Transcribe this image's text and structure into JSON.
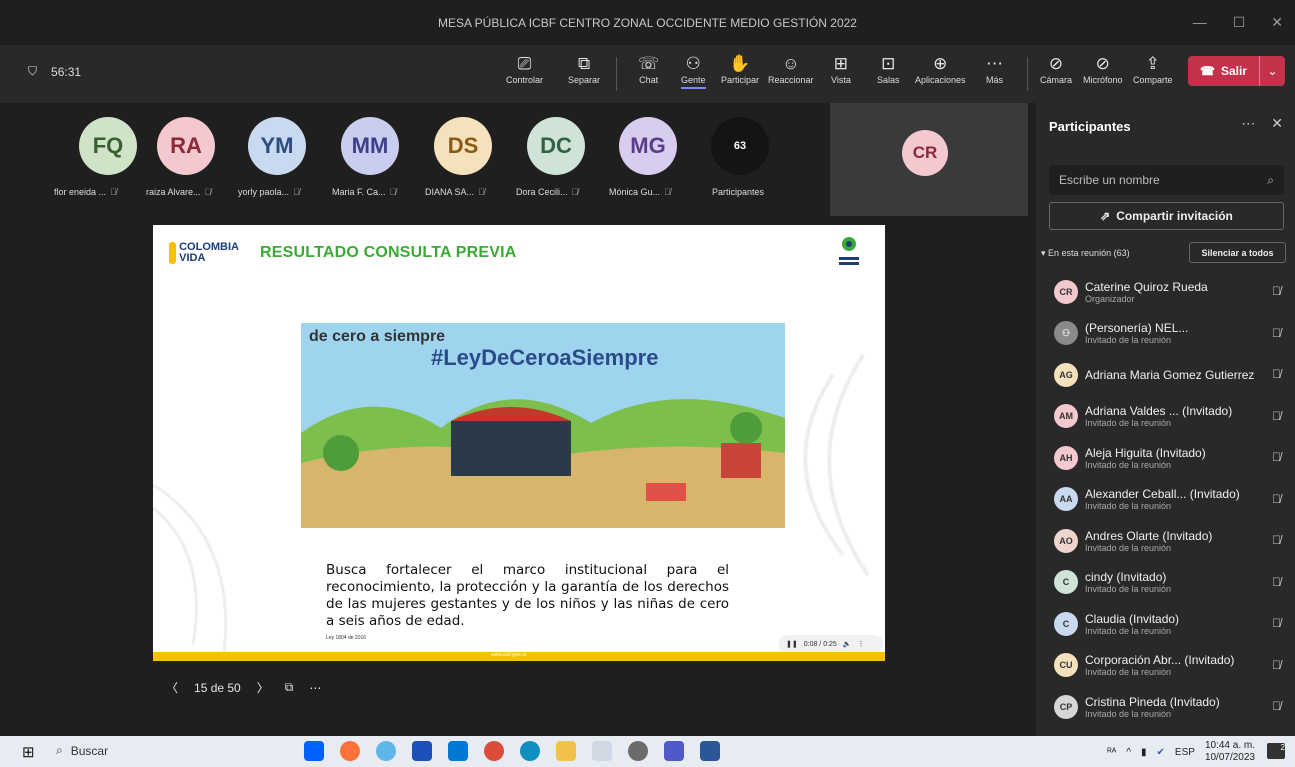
{
  "window": {
    "title": "MESA PÚBLICA ICBF CENTRO ZONAL OCCIDENTE MEDIO GESTIÓN 2022",
    "controls": [
      "—",
      "☐",
      "✕"
    ]
  },
  "meeting": {
    "timer": "56:31"
  },
  "toolbar": {
    "items": [
      {
        "label": "Controlar",
        "icon": "monitor-icon"
      },
      {
        "label": "Separar",
        "icon": "popout-icon"
      },
      {
        "label": "Chat",
        "icon": "chat-icon"
      },
      {
        "label": "Gente",
        "icon": "people-icon",
        "active": true
      },
      {
        "label": "Participar",
        "icon": "raise-hand-icon"
      },
      {
        "label": "Reaccionar",
        "icon": "emoji-icon"
      },
      {
        "label": "Vista",
        "icon": "grid-icon"
      },
      {
        "label": "Salas",
        "icon": "rooms-icon"
      },
      {
        "label": "Aplicaciones",
        "icon": "add-app-icon"
      },
      {
        "label": "Más",
        "icon": "more-icon"
      },
      {
        "label": "Cámara",
        "icon": "camera-off-icon"
      },
      {
        "label": "Micrófono",
        "icon": "mic-off-icon"
      },
      {
        "label": "Comparte",
        "icon": "share-icon"
      }
    ],
    "leave_label": "Salir",
    "accent": "#7f85f5",
    "leave_color": "#c4314b"
  },
  "gallery": {
    "avatars": [
      {
        "initials": "FQ",
        "name": "flor eneida ...",
        "bg": "#cfe3c8",
        "fg": "#3a5f2e"
      },
      {
        "initials": "RA",
        "name": "raiza Alvare...",
        "bg": "#f3c8cf",
        "fg": "#8a2a3b"
      },
      {
        "initials": "YM",
        "name": "yorly paola...",
        "bg": "#c8d9f0",
        "fg": "#2b4c7e"
      },
      {
        "initials": "MM",
        "name": "Maria F. Ca...",
        "bg": "#c9cdef",
        "fg": "#3e3f8a"
      },
      {
        "initials": "DS",
        "name": "DIANA SA...",
        "bg": "#f6e1bd",
        "fg": "#8a5a12"
      },
      {
        "initials": "DC",
        "name": "Dora Cecili...",
        "bg": "#cfe3d6",
        "fg": "#2f6145"
      },
      {
        "initials": "MG",
        "name": "Mónica Gu...",
        "bg": "#d9cdef",
        "fg": "#5a3e8a"
      }
    ],
    "overflow_count": "63",
    "overflow_label": "Participantes",
    "spotlight_initials": "CR"
  },
  "slide": {
    "logo_text": "COLOMBIA\nVIDA",
    "heading": "RESULTADO CONSULTA PREVIA",
    "banner_hashtag": "#LeyDeCeroaSiempre",
    "banner_brand": "de cero a siempre",
    "body": "Busca fortalecer el marco institucional para el reconocimiento, la protección y la garantía de los derechos de las mujeres gestantes y de los niños y las niñas de cero a seis años de edad.",
    "law": "Ley 1804 de 2016",
    "footer_url": "www.icbf.gov.co",
    "player_time": "0:08 / 0:25",
    "page": "15 de 50"
  },
  "participants": {
    "title": "Participantes",
    "search_placeholder": "Escribe un nombre",
    "share_label": "Compartir invitación",
    "section_label": "En esta reunión (63)",
    "mute_all_label": "Silenciar a todos",
    "list": [
      {
        "initials": "CR",
        "name": "Caterine Quiroz Rueda",
        "role": "Organizador",
        "bg": "#f3c8cf"
      },
      {
        "initials": "",
        "name": "(Personería) NEL...",
        "role": "Invitado de la reunión",
        "bg": "#8a8a8a"
      },
      {
        "initials": "AG",
        "name": "Adriana Maria Gomez Gutierrez",
        "role": "",
        "bg": "#f6e1bd"
      },
      {
        "initials": "AM",
        "name": "Adriana Valdes ...  (Invitado)",
        "role": "Invitado de la reunión",
        "bg": "#f3c8cf"
      },
      {
        "initials": "AH",
        "name": "Aleja Higuita (Invitado)",
        "role": "Invitado de la reunión",
        "bg": "#f3c8cf"
      },
      {
        "initials": "AA",
        "name": "Alexander Ceball... (Invitado)",
        "role": "Invitado de la reunión",
        "bg": "#c8d9f0"
      },
      {
        "initials": "AO",
        "name": "Andres Olarte (Invitado)",
        "role": "Invitado de la reunión",
        "bg": "#f0d5cf"
      },
      {
        "initials": "C",
        "name": "cindy (Invitado)",
        "role": "Invitado de la reunión",
        "bg": "#cfe3d6"
      },
      {
        "initials": "C",
        "name": "Claudia (Invitado)",
        "role": "Invitado de la reunión",
        "bg": "#c8d9f0"
      },
      {
        "initials": "CU",
        "name": "Corporación Abr... (Invitado)",
        "role": "Invitado de la reunión",
        "bg": "#f6e1bd"
      },
      {
        "initials": "CP",
        "name": "Cristina Pineda (Invitado)",
        "role": "Invitado de la reunión",
        "bg": "#d6d6d6"
      }
    ]
  },
  "taskbar": {
    "search_label": "Buscar",
    "language": "ESP",
    "time": "10:44 a. m.",
    "date": "10/07/2023",
    "notifications": "2"
  }
}
